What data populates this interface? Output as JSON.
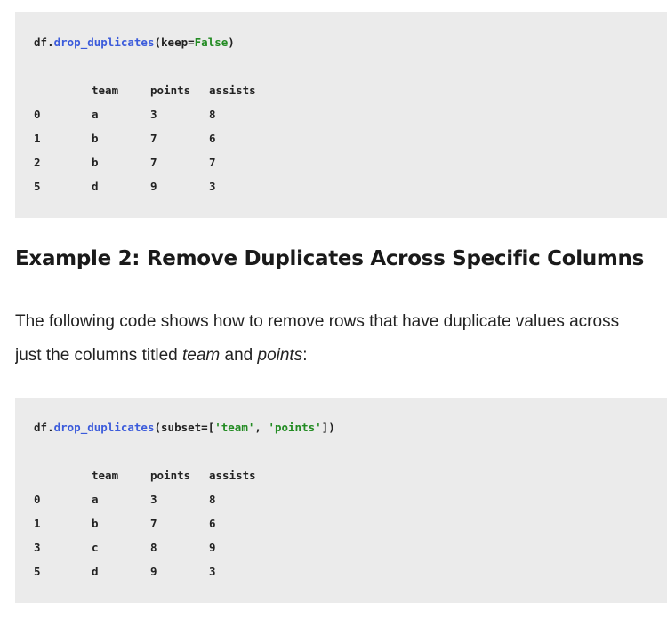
{
  "example1": {
    "code": {
      "obj": "df",
      "dot": ".",
      "func": "drop_duplicates",
      "open": "(",
      "param": "keep=",
      "value": "False",
      "close": ")"
    },
    "table": {
      "columns": [
        "team",
        "points",
        "assists"
      ],
      "rows": [
        {
          "index": "0",
          "team": "a",
          "points": "3",
          "assists": "8"
        },
        {
          "index": "1",
          "team": "b",
          "points": "7",
          "assists": "6"
        },
        {
          "index": "2",
          "team": "b",
          "points": "7",
          "assists": "7"
        },
        {
          "index": "5",
          "team": "d",
          "points": "9",
          "assists": "3"
        }
      ]
    }
  },
  "heading": "Example 2: Remove Duplicates Across Specific Columns",
  "paragraph": {
    "line1": "The following code shows how to remove rows that have duplicate values across",
    "line2_pre": "just the columns titled ",
    "line2_em1": "team",
    "line2_mid": " and ",
    "line2_em2": "points",
    "line2_post": ":"
  },
  "example2": {
    "code": {
      "obj": "df",
      "dot": ".",
      "func": "drop_duplicates",
      "open": "(",
      "param": "subset=[",
      "str1": "'team'",
      "sep": ", ",
      "str2": "'points'",
      "close": "])"
    },
    "table": {
      "columns": [
        "team",
        "points",
        "assists"
      ],
      "rows": [
        {
          "index": "0",
          "team": "a",
          "points": "3",
          "assists": "8"
        },
        {
          "index": "1",
          "team": "b",
          "points": "7",
          "assists": "6"
        },
        {
          "index": "3",
          "team": "c",
          "points": "8",
          "assists": "9"
        },
        {
          "index": "5",
          "team": "d",
          "points": "9",
          "assists": "3"
        }
      ]
    }
  }
}
